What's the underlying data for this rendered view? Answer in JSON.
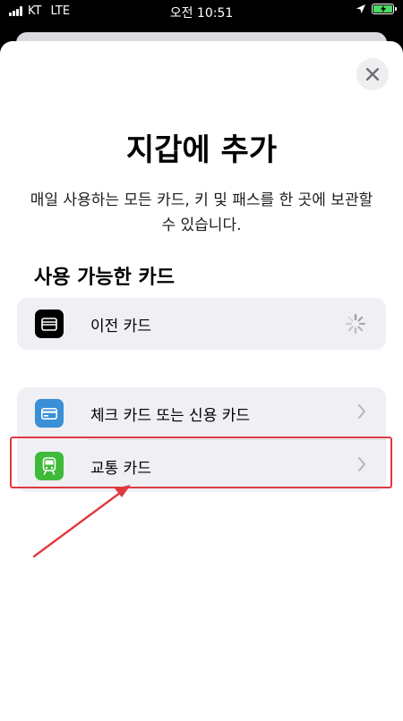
{
  "status_bar": {
    "carrier": "KT",
    "network": "LTE",
    "time": "오전 10:51"
  },
  "sheet": {
    "title": "지갑에 추가",
    "subtitle": "매일 사용하는 모든 카드, 키 및 패스를 한 곳에 보관할 수 있습니다."
  },
  "available": {
    "heading": "사용 가능한 카드",
    "previous_card": {
      "label": "이전 카드",
      "icon": "wallet-icon"
    }
  },
  "add_options": [
    {
      "label": "체크 카드 또는 신용 카드",
      "icon": "credit-card-icon",
      "icon_color": "#2f7fd8"
    },
    {
      "label": "교통 카드",
      "icon": "train-icon",
      "icon_color": "#3fba3a"
    }
  ],
  "colors": {
    "accent": "#e0393e",
    "group_bg": "#efeff4"
  }
}
